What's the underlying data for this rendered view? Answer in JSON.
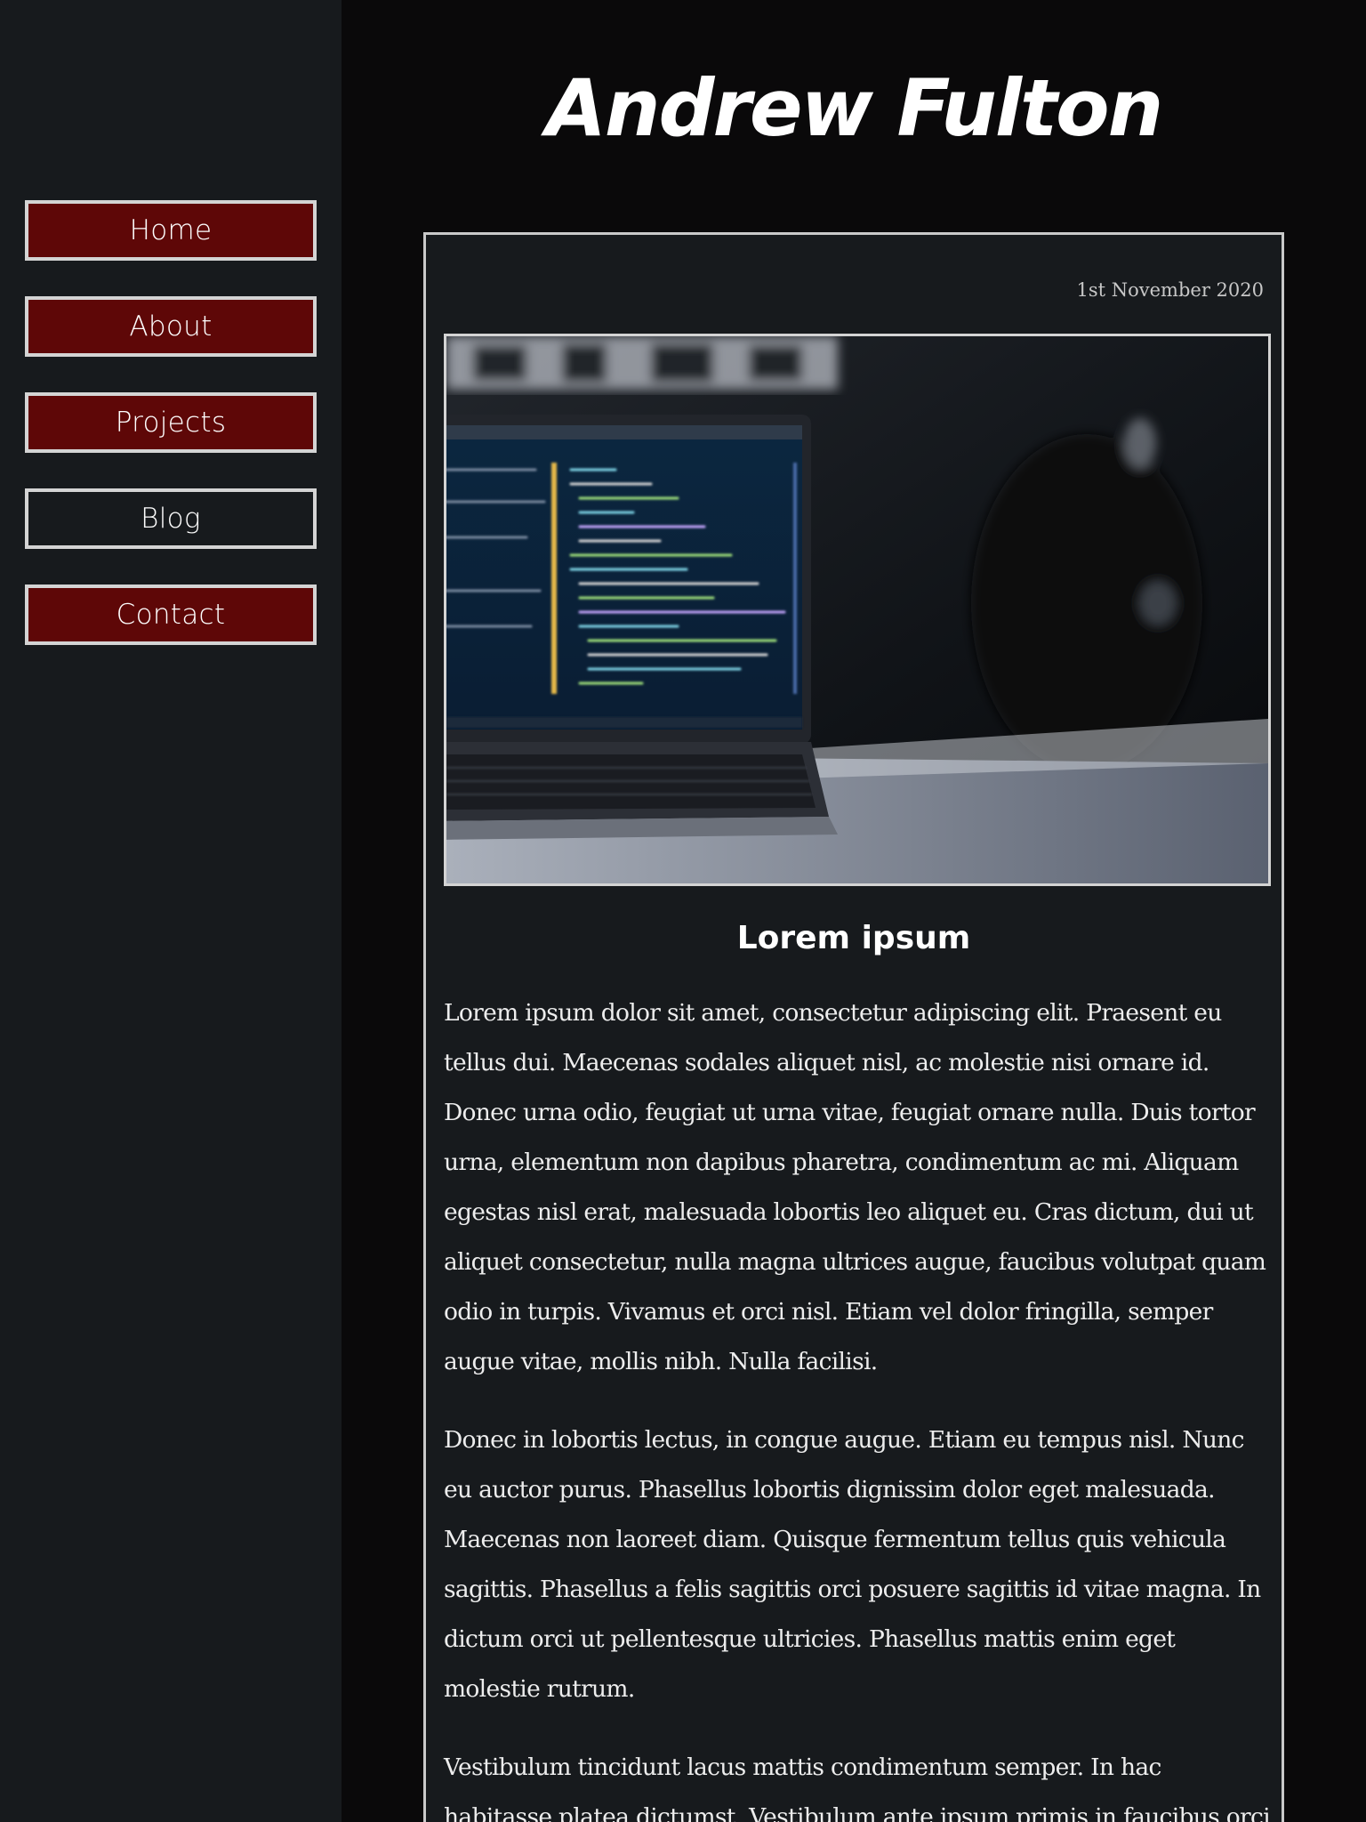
{
  "site": {
    "title": "Andrew Fulton"
  },
  "nav": {
    "items": [
      {
        "label": "Home"
      },
      {
        "label": "About"
      },
      {
        "label": "Projects"
      },
      {
        "label": "Blog"
      },
      {
        "label": "Contact"
      }
    ],
    "active": "Blog"
  },
  "post": {
    "date": "1st November 2020",
    "image_alt": "Laptop on a desk displaying code in an editor",
    "heading": "Lorem ipsum",
    "paragraphs": [
      "Lorem ipsum dolor sit amet, consectetur adipiscing elit. Praesent eu tellus dui. Maecenas sodales aliquet nisl, ac molestie nisi ornare id. Donec urna odio, feugiat ut urna vitae, feugiat ornare nulla. Duis tortor urna, elementum non dapibus pharetra, condimentum ac mi. Aliquam egestas nisl erat, malesuada lobortis leo aliquet eu. Cras dictum, dui ut aliquet consectetur, nulla magna ultrices augue, faucibus volutpat quam odio in turpis. Vivamus et orci nisl. Etiam vel dolor fringilla, semper augue vitae, mollis nibh. Nulla facilisi.",
      "Donec in lobortis lectus, in congue augue. Etiam eu tempus nisl. Nunc eu auctor purus. Phasellus lobortis dignissim dolor eget malesuada. Maecenas non laoreet diam. Quisque fermentum tellus quis vehicula sagittis. Phasellus a felis sagittis orci posuere sagittis id vitae magna. In dictum orci ut pellentesque ultricies. Phasellus mattis enim eget molestie rutrum.",
      "Vestibulum tincidunt lacus mattis condimentum semper. In hac habitasse platea dictumst. Vestibulum ante ipsum primis in faucibus orci"
    ]
  },
  "colors": {
    "page_bg": "#0a090a",
    "panel_bg": "#171a1d",
    "nav_button_bg": "#5e0707",
    "border": "#d4d4d4",
    "text": "#ffffff"
  }
}
